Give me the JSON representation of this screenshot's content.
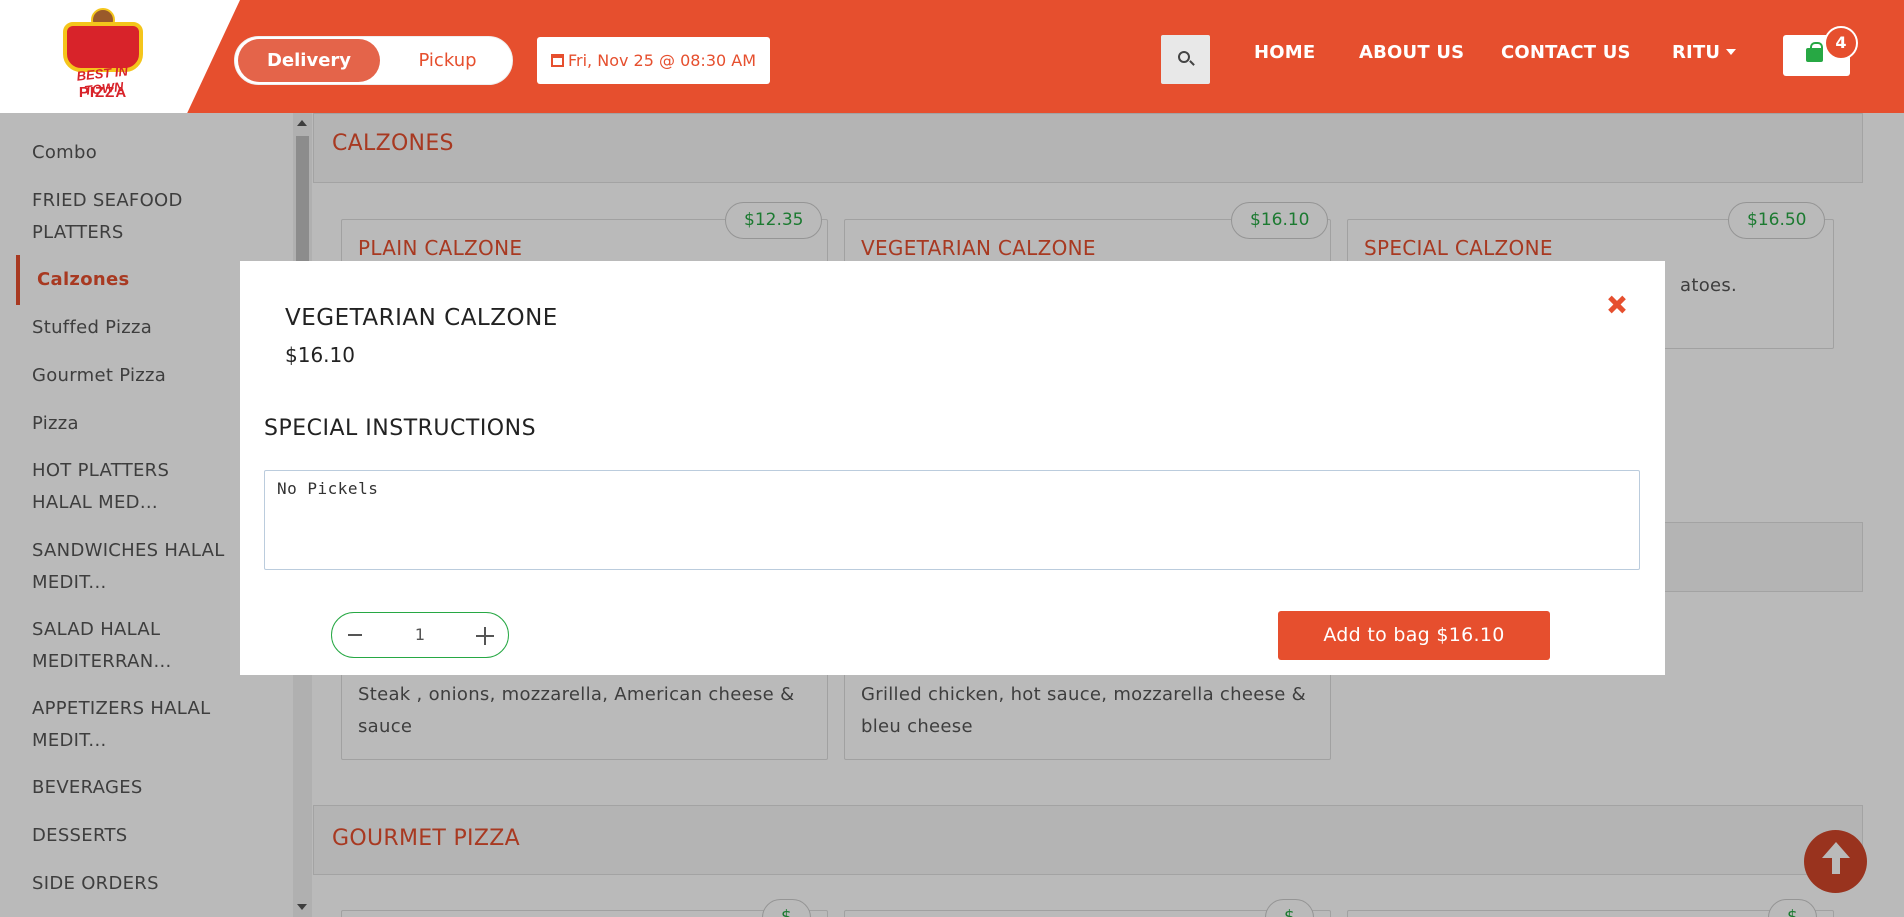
{
  "brand": {
    "line1": "BEST IN TOWN",
    "line2": "PIZZA"
  },
  "header": {
    "mode_delivery": "Delivery",
    "mode_pickup": "Pickup",
    "datetime": "Fri, Nov 25 @ 08:30 AM",
    "nav": [
      "HOME",
      "ABOUT US",
      "CONTACT US",
      "RITU"
    ],
    "cart_count": "4"
  },
  "sidebar": {
    "items": [
      {
        "label": "Combo"
      },
      {
        "label": "FRIED SEAFOOD PLATTERS"
      },
      {
        "label": "Calzones"
      },
      {
        "label": "Stuffed Pizza"
      },
      {
        "label": "Gourmet Pizza"
      },
      {
        "label": "Pizza"
      },
      {
        "label": "HOT PLATTERS HALAL MED..."
      },
      {
        "label": "SANDWICHES HALAL MEDIT..."
      },
      {
        "label": "SALAD HALAL MEDITERRAN..."
      },
      {
        "label": "APPETIZERS HALAL MEDIT..."
      },
      {
        "label": "BEVERAGES"
      },
      {
        "label": "DESSERTS"
      },
      {
        "label": "SIDE ORDERS"
      }
    ]
  },
  "main": {
    "category1": "CALZONES",
    "cards": [
      {
        "title": "PLAIN CALZONE",
        "price": "$12.35"
      },
      {
        "title": "VEGETARIAN CALZONE",
        "price": "$16.10"
      },
      {
        "title": "SPECIAL CALZONE",
        "price": "$16.50",
        "desc_fragment": "atoes."
      }
    ],
    "cards_row2": [
      {
        "desc": "Steak , onions, mozzarella, American cheese & sauce"
      },
      {
        "desc": "Grilled chicken, hot sauce, mozzarella cheese & bleu cheese"
      }
    ],
    "category2": "GOURMET PIZZA",
    "row3_prices": [
      "$",
      "$",
      "$"
    ]
  },
  "modal": {
    "title": "VEGETARIAN CALZONE",
    "price": "$16.10",
    "instructions_label": "SPECIAL INSTRUCTIONS",
    "instructions_value": "No Pickels",
    "quantity": "1",
    "add_button": "Add to bag $16.10"
  }
}
